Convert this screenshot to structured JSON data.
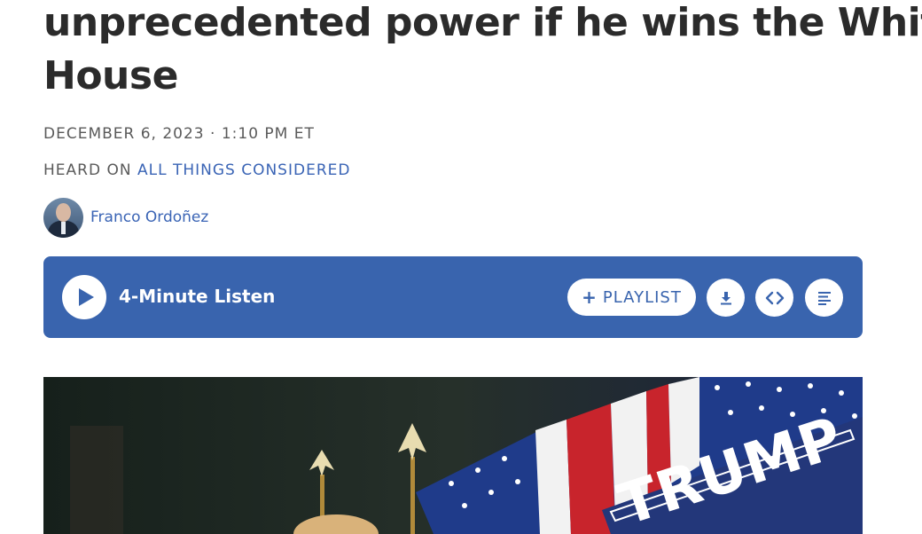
{
  "article": {
    "headline_line1": "unprecedented power if he wins the White",
    "headline_line2": "House",
    "dateline": "DECEMBER 6, 2023 · 1:10 PM ET",
    "heard_on_prefix": "HEARD ON ",
    "program": "ALL THINGS CONSIDERED",
    "author": "Franco Ordoñez"
  },
  "player": {
    "listen_label": "4-Minute Listen",
    "playlist_label": "PLAYLIST",
    "icons": [
      "play-icon",
      "plus-icon",
      "download-icon",
      "embed-icon",
      "transcript-icon"
    ]
  },
  "photo": {
    "sign_text": "TRUMP"
  },
  "colors": {
    "accent": "#3964ae",
    "link": "#3a64b5",
    "headline": "#2b2b2b",
    "meta": "#5a5a5a"
  }
}
